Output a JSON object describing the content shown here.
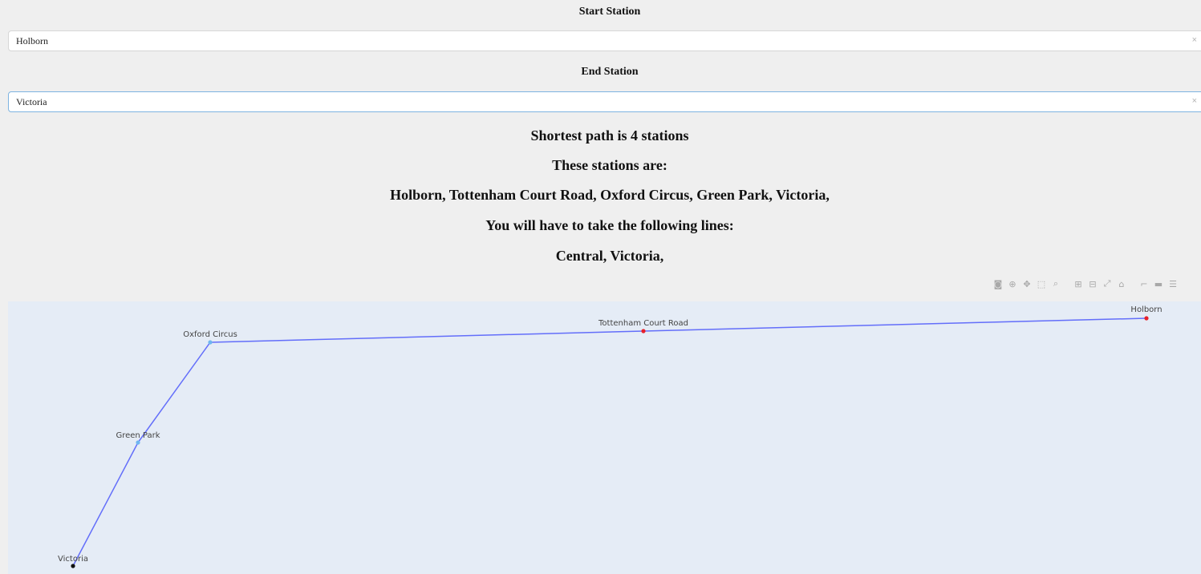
{
  "start": {
    "heading": "Start Station",
    "value": "Holborn",
    "clear_glyph": "×",
    "arrow_glyph": "▾"
  },
  "end": {
    "heading": "End Station",
    "value": "Victoria",
    "clear_glyph": "×",
    "arrow_glyph": "▾"
  },
  "result": {
    "shortest": "Shortest path is 4 stations",
    "stations_heading": "These stations are:",
    "stations_list": "Holborn, Tottenham Court Road, Oxford Circus, Green Park, Victoria,",
    "lines_heading": "You will have to take the following lines:",
    "lines_list": "Central, Victoria,"
  },
  "modebar": [
    {
      "name": "camera-icon",
      "glyph": "◙"
    },
    {
      "name": "zoom-icon",
      "glyph": "⊕"
    },
    {
      "name": "pan-icon",
      "glyph": "✥"
    },
    {
      "name": "box-select-icon",
      "glyph": "⬚"
    },
    {
      "name": "lasso-select-icon",
      "glyph": "⌕"
    },
    {
      "name": "sep"
    },
    {
      "name": "zoom-in-icon",
      "glyph": "⊞"
    },
    {
      "name": "zoom-out-icon",
      "glyph": "⊟"
    },
    {
      "name": "autoscale-icon",
      "glyph": "⤢"
    },
    {
      "name": "reset-axes-icon",
      "glyph": "⌂"
    },
    {
      "name": "sep"
    },
    {
      "name": "spike-lines-icon",
      "glyph": "⌐"
    },
    {
      "name": "hover-closest-icon",
      "glyph": "▬"
    },
    {
      "name": "hover-compare-icon",
      "glyph": "☰"
    }
  ],
  "graph": {
    "edge_color": "#636efa",
    "nodes": [
      {
        "name": "Holborn",
        "color": "#e8202a"
      },
      {
        "name": "Tottenham Court Road",
        "color": "#e8202a"
      },
      {
        "name": "Oxford Circus",
        "color": "#6fb6f0"
      },
      {
        "name": "Green Park",
        "color": "#6fb6f0"
      },
      {
        "name": "Victoria",
        "color": "#111111"
      }
    ]
  }
}
